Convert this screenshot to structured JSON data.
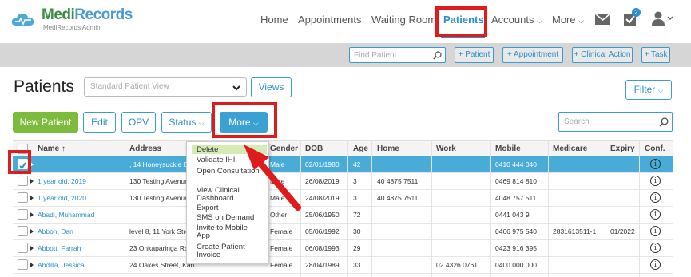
{
  "brand": {
    "name_a": "Medi",
    "name_b": "Records",
    "sub": "MediRecords Admin"
  },
  "nav": {
    "home": "Home",
    "appointments": "Appointments",
    "waiting_room": "Waiting Room",
    "patients": "Patients",
    "accounts": "Accounts",
    "more": "More",
    "badge": "2"
  },
  "toolbar": {
    "find_placeholder": "Find Patient",
    "add_patient": "+ Patient",
    "add_appointment": "+ Appointment",
    "add_clinical": "+ Clinical Action",
    "add_task": "+ Task"
  },
  "page": {
    "title": "Patients",
    "view_select": "Standard Patient View",
    "views_btn": "Views",
    "filter_btn": "Filter"
  },
  "actions": {
    "new_patient": "New Patient",
    "edit": "Edit",
    "opv": "OPV",
    "status": "Status",
    "more": "More",
    "search_placeholder": "Search"
  },
  "table": {
    "headers": {
      "name": "Name",
      "address": "Address",
      "gender": "Gender",
      "dob": "DOB",
      "age": "Age",
      "home": "Home",
      "work": "Work",
      "mobile": "Mobile",
      "medicare": "Medicare",
      "expiry": "Expiry",
      "conf": "Conf."
    },
    "rows": [
      {
        "name": "",
        "address": ", 14 Honeysuckle D",
        "gender": "Male",
        "dob": "02/01/1980",
        "age": "42",
        "home": "",
        "work": "",
        "mobile": "0410 444 040",
        "medicare": "",
        "expiry": ""
      },
      {
        "name": "1 year old, 2019",
        "address": "130 Testing Avenue",
        "gender": "Male",
        "dob": "26/08/2019",
        "age": "3",
        "home": "40 4875 7511",
        "work": "",
        "mobile": "0469 814 810",
        "medicare": "",
        "expiry": ""
      },
      {
        "name": "1 year old, 2020",
        "address": "130 Testing Avenue",
        "gender": "Male",
        "dob": "24/08/2019",
        "age": "3",
        "home": "40 4875 7511",
        "work": "",
        "mobile": "4048 757 511",
        "medicare": "",
        "expiry": ""
      },
      {
        "name": "Abadi, Muhammad",
        "address": "",
        "gender": "Other",
        "dob": "25/06/1950",
        "age": "72",
        "home": "",
        "work": "",
        "mobile": "0441 043 9",
        "medicare": "",
        "expiry": ""
      },
      {
        "name": "Abbon, Dan",
        "address": "level 8, 11 York Stre",
        "gender": "Female",
        "dob": "05/06/1992",
        "age": "30",
        "home": "",
        "work": "",
        "mobile": "0466 975 540",
        "medicare": "2831613511-1",
        "expiry": "01/2022"
      },
      {
        "name": "Abbott, Farrah",
        "address": "23 Onkaparinga Ro",
        "gender": "Female",
        "dob": "06/08/1993",
        "age": "29",
        "home": "",
        "work": "",
        "mobile": "0423 916 395",
        "medicare": "",
        "expiry": ""
      },
      {
        "name": "Abdilla, Jessica",
        "address": "24 Oakes Street, Kan",
        "gender": "Female",
        "dob": "28/04/1989",
        "age": "33",
        "home": "",
        "work": "02 4326 0761",
        "mobile": "0400 000 000",
        "medicare": "",
        "expiry": ""
      }
    ]
  },
  "more_menu": [
    "Delete",
    "Validate IHI",
    "Open Consultation",
    "View Clinical Dashboard",
    "Export",
    "SMS on Demand",
    "Invite to Mobile App",
    "Create Patient Invoice"
  ],
  "colors": {
    "accent": "#2d8ec9",
    "green": "#7dbb3c",
    "selected_row": "#49acd8",
    "highlight_box": "#e01b1b"
  }
}
